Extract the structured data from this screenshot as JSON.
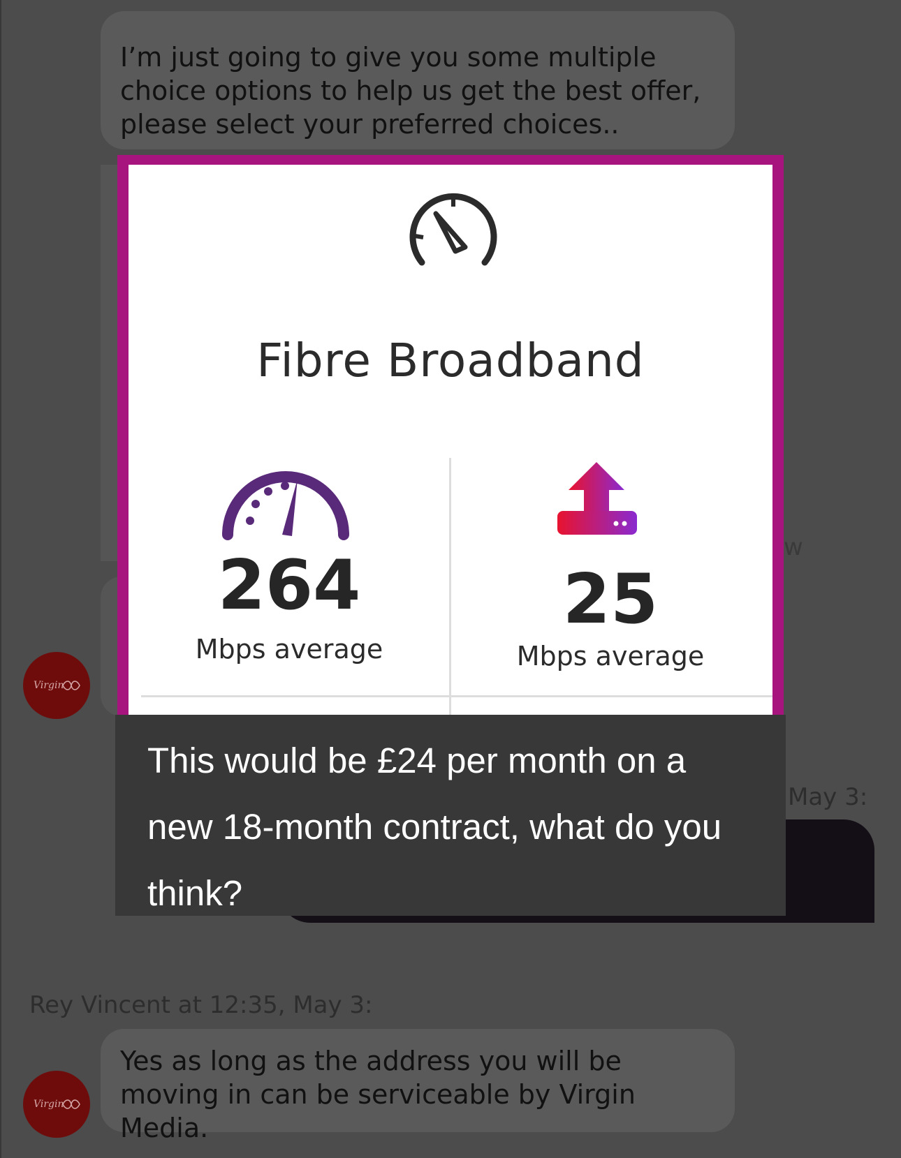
{
  "messages": {
    "agent_intro": "I’m just going to give you some multiple choice options to help us get the best offer, please select your preferred choices..",
    "agent_reply": "Yes as long as the address you will be moving in can be serviceable by Virgin Media."
  },
  "meta": {
    "partial_timestamp": "May 3:",
    "partial_char": "w",
    "agent_timestamp": "Rey Vincent at 12:35, May 3:"
  },
  "card": {
    "title": "Fibre Broadband",
    "download": {
      "value": "264",
      "unit": "Mbps average"
    },
    "upload": {
      "value": "25",
      "unit": "Mbps average"
    }
  },
  "tooltip": {
    "text": "This would be £24 per month on a new 18-month contract, what do you think?"
  },
  "icons": {
    "speedometer": "speedometer-icon",
    "gauge": "gauge-icon",
    "upload": "upload-icon",
    "avatar": "virgin-media-logo-icon"
  },
  "colors": {
    "brand": "#a7147d",
    "avatar": "#6e0c0c",
    "gauge": "#5a2a7a"
  }
}
